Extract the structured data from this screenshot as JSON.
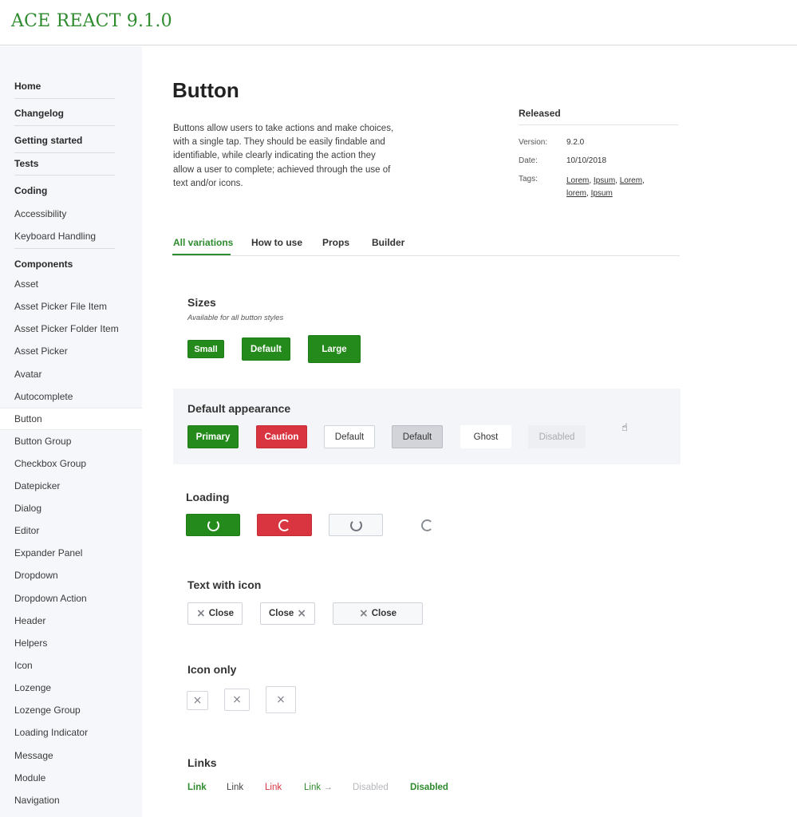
{
  "app": {
    "title": "ACE REACT 9.1.0"
  },
  "sidebar": {
    "items": [
      {
        "label": "Home"
      },
      {
        "label": "Changelog"
      },
      {
        "label": "Getting started"
      },
      {
        "label": "Tests"
      },
      {
        "label": "Coding"
      },
      {
        "label": "Accessibility"
      },
      {
        "label": "Keyboard Handling"
      },
      {
        "label": "Components"
      },
      {
        "label": "Asset"
      },
      {
        "label": "Asset Picker File Item"
      },
      {
        "label": "Asset Picker Folder Item"
      },
      {
        "label": "Asset Picker"
      },
      {
        "label": "Avatar"
      },
      {
        "label": "Autocomplete"
      },
      {
        "label": "Button"
      },
      {
        "label": "Button Group"
      },
      {
        "label": "Checkbox Group"
      },
      {
        "label": "Datepicker"
      },
      {
        "label": "Dialog"
      },
      {
        "label": "Editor"
      },
      {
        "label": "Expander Panel"
      },
      {
        "label": "Dropdown"
      },
      {
        "label": "Dropdown Action"
      },
      {
        "label": "Header"
      },
      {
        "label": "Helpers"
      },
      {
        "label": "Icon"
      },
      {
        "label": "Lozenge"
      },
      {
        "label": "Lozenge Group"
      },
      {
        "label": "Loading Indicator"
      },
      {
        "label": "Message"
      },
      {
        "label": "Module"
      },
      {
        "label": "Navigation"
      }
    ]
  },
  "page": {
    "title": "Button",
    "intro": "Buttons allow users to take actions and make choices, with a single tap. They should be easily findable and identifiable, while clearly indicating the action they allow a user to complete; achieved through the use of text and/or icons."
  },
  "meta": {
    "title": "Released",
    "version_label": "Version:",
    "version": "9.2.0",
    "date_label": "Date:",
    "date": "10/10/2018",
    "tags_label": "Tags:",
    "tags": [
      "Lorem",
      "Ipsum",
      "Lorem",
      "lorem",
      "Ipsum"
    ]
  },
  "tabs": [
    {
      "label": "All variations"
    },
    {
      "label": "How to use"
    },
    {
      "label": "Props"
    },
    {
      "label": "Builder"
    }
  ],
  "sizes": {
    "title": "Sizes",
    "subtitle": "Available for all button styles",
    "small": "Small",
    "default": "Default",
    "large": "Large"
  },
  "appearance": {
    "title": "Default appearance",
    "primary": "Primary",
    "caution": "Caution",
    "default": "Default",
    "default_pressed": "Default",
    "ghost": "Ghost",
    "disabled": "Disabled"
  },
  "loading": {
    "title": "Loading"
  },
  "text_icon": {
    "title": "Text with icon",
    "label": "Close"
  },
  "icon_only": {
    "title": "Icon only"
  },
  "links": {
    "title": "Links",
    "link_green": "Link",
    "link_dark": "Link",
    "link_red": "Link",
    "link_arrow": "Link",
    "disabled_grey": "Disabled",
    "disabled_green": "Disabled"
  },
  "colors": {
    "brand": "#2e8b2e",
    "primary": "#248a1c",
    "caution": "#d93540",
    "disabled_text": "#a9abb0"
  },
  "icons": {
    "close": "×",
    "arrow": "→",
    "cursor": "pointer-hand-icon"
  }
}
